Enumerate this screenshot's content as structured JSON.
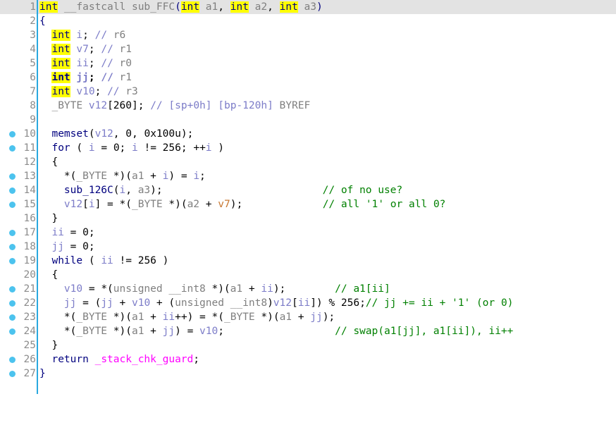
{
  "editor": {
    "kind": "ida-pro-pseudocode-view",
    "language": "C",
    "function_name": "sub_FFC",
    "total_lines": 27,
    "current_line": 1,
    "colors": {
      "background": "#ffffff",
      "current_line_highlight": "#e3e3e3",
      "gutter_text": "#8c8c8c",
      "breakpoint_dot": "#4cc3ee",
      "fold_line": "#29a8df",
      "keyword": "#00007f",
      "highlight_token": "#ffff00",
      "type": "#7f7f7f",
      "local_variable": "#7c7cc8",
      "register_variable": "#c87832",
      "comment": "#008000",
      "bracket_comment": "#7c7cc8",
      "global_symbol": "#ff00ff"
    },
    "lines": [
      {
        "n": "1",
        "bp": false,
        "current": true
      },
      {
        "n": "2",
        "bp": false,
        "current": false
      },
      {
        "n": "3",
        "bp": false,
        "current": false
      },
      {
        "n": "4",
        "bp": false,
        "current": false
      },
      {
        "n": "5",
        "bp": false,
        "current": false
      },
      {
        "n": "6",
        "bp": false,
        "current": false
      },
      {
        "n": "7",
        "bp": false,
        "current": false
      },
      {
        "n": "8",
        "bp": false,
        "current": false
      },
      {
        "n": "9",
        "bp": false,
        "current": false
      },
      {
        "n": "10",
        "bp": true,
        "current": false
      },
      {
        "n": "11",
        "bp": true,
        "current": false
      },
      {
        "n": "12",
        "bp": false,
        "current": false
      },
      {
        "n": "13",
        "bp": true,
        "current": false
      },
      {
        "n": "14",
        "bp": true,
        "current": false
      },
      {
        "n": "15",
        "bp": true,
        "current": false
      },
      {
        "n": "16",
        "bp": false,
        "current": false
      },
      {
        "n": "17",
        "bp": true,
        "current": false
      },
      {
        "n": "18",
        "bp": true,
        "current": false
      },
      {
        "n": "19",
        "bp": true,
        "current": false
      },
      {
        "n": "20",
        "bp": false,
        "current": false
      },
      {
        "n": "21",
        "bp": true,
        "current": false
      },
      {
        "n": "22",
        "bp": true,
        "current": false
      },
      {
        "n": "23",
        "bp": true,
        "current": false
      },
      {
        "n": "24",
        "bp": true,
        "current": false
      },
      {
        "n": "25",
        "bp": false,
        "current": false
      },
      {
        "n": "26",
        "bp": true,
        "current": false
      },
      {
        "n": "27",
        "bp": true,
        "current": false
      }
    ],
    "code_text": {
      "l1": "int __fastcall sub_FFC(int a1, int a2, int a3)",
      "l2": "{",
      "l3": "  int i; // r6",
      "l4": "  int v7; // r1",
      "l5": "  int ii; // r0",
      "l6": "  int jj; // r1",
      "l7": "  int v10; // r3",
      "l8": "  _BYTE v12[260]; // [sp+0h] [bp-120h] BYREF",
      "l9": "",
      "l10": "  memset(v12, 0, 0x100u);",
      "l11": "  for ( i = 0; i != 256; ++i )",
      "l12": "  {",
      "l13": "    *(_BYTE *)(a1 + i) = i;",
      "l14": "    sub_126C(i, a3);                          // of no use?",
      "l15": "    v12[i] = *(_BYTE *)(a2 + v7);             // all '1' or all 0?",
      "l16": "  }",
      "l17": "  ii = 0;",
      "l18": "  jj = 0;",
      "l19": "  while ( ii != 256 )",
      "l20": "  {",
      "l21": "    v10 = *(unsigned __int8 *)(a1 + ii);        // a1[ii]",
      "l22": "    jj = (jj + v10 + (unsigned __int8)v12[ii]) % 256;// jj += ii + '1' (or 0)",
      "l23": "    *(_BYTE *)(a1 + ii++) = *(_BYTE *)(a1 + jj);",
      "l24": "    *(_BYTE *)(a1 + jj) = v10;                  // swap(a1[jj], a1[ii]), ii++",
      "l25": "  }",
      "l26": "  return _stack_chk_guard;",
      "l27": "}"
    },
    "comments": {
      "l3": "// r6",
      "l4": "// r1",
      "l5": "// r0",
      "l6": "// r1",
      "l7": "// r3",
      "l8": "// [sp+0h] [bp-120h] BYREF",
      "l14": "// of no use?",
      "l15": "// all '1' or all 0?",
      "l21": "// a1[ii]",
      "l22": "// jj += ii + '1' (or 0)",
      "l24": "// swap(a1[jj], a1[ii]), ii++"
    },
    "tokens": {
      "kw_int": "int",
      "kw_for": "for",
      "kw_while": "while",
      "kw_return": "return",
      "kw_unsigned": "unsigned",
      "t_fastcall": "__fastcall",
      "t_byte": "_BYTE",
      "t_int8": "__int8",
      "fn_main": "sub_FFC",
      "fn_memset": "memset",
      "fn_sub126c": "sub_126C",
      "a1": "a1",
      "a2": "a2",
      "a3": "a3",
      "v_i": "i",
      "v_v7": "v7",
      "v_ii": "ii",
      "v_jj": "jj",
      "v_v10": "v10",
      "v_v12": "v12",
      "glob_guard": "_stack_chk_guard",
      "n_0": "0",
      "n_256": "256",
      "n_260": "260",
      "n_0x100u": "0x100u"
    }
  }
}
